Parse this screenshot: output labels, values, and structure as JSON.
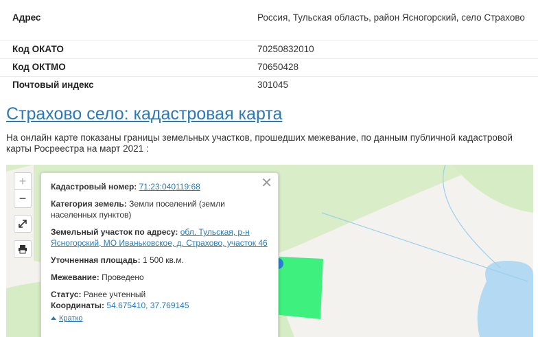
{
  "info": {
    "rows": [
      {
        "label": "Адрес",
        "value": "Россия, Тульская область, район Ясногорский, село Страхово"
      },
      {
        "label": "Код ОКАТО",
        "value": "70250832010"
      },
      {
        "label": "Код ОКТМО",
        "value": "70650428"
      },
      {
        "label": "Почтовый индекс",
        "value": "301045"
      }
    ]
  },
  "heading": "Страхово село: кадастровая карта",
  "description": "На онлайн карте показаны границы земельных участков, прошедших межевание, по данным публичной кадастровой карты Росреестра на март 2021 :",
  "map": {
    "controls": {
      "zoom_in": "+",
      "zoom_out": "−"
    },
    "popup": {
      "close": "✕",
      "cadastral_label": "Кадастровый номер:",
      "cadastral_value": "71:23:040119:68",
      "category_label": "Категория земель:",
      "category_value": "Земли поселений (земли населенных пунктов)",
      "address_label": "Земельный участок по адресу:",
      "address_value": "обл. Тульская, р-н Ясногорский, МО Иваньковское, д. Страхово, участок 46",
      "area_label": "Уточненная площадь:",
      "area_value": "1 500 кв.м.",
      "survey_label": "Межевание:",
      "survey_value": "Проведено",
      "status_label": "Статус:",
      "status_value": "Ранее учтенный",
      "coords_label": "Координаты:",
      "coords_value": "54.675410, 37.769145",
      "brief": "Кратко"
    },
    "colors": {
      "land": "#f4f2ee",
      "forest": "#d6ecc4",
      "water": "#b4d9f2",
      "parcel": "#3ef07d",
      "marker": "#2b7fd1"
    }
  }
}
